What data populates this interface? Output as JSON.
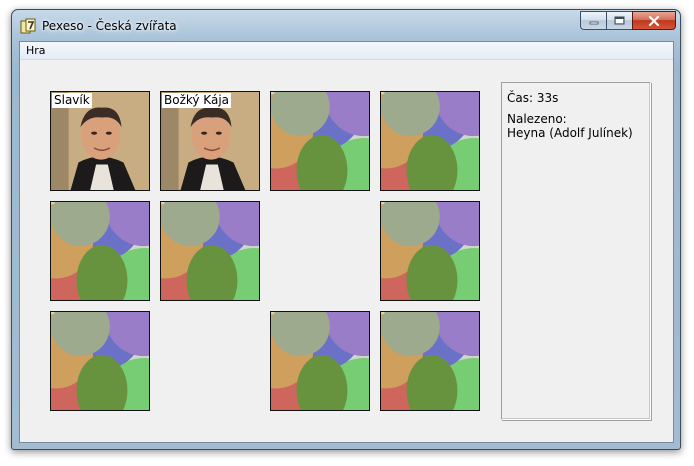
{
  "window": {
    "title": "Pexeso - Česká zvířata",
    "icon": "app-icon"
  },
  "menu": {
    "items": [
      {
        "label": "Hra"
      }
    ]
  },
  "cards": [
    {
      "state": "revealed",
      "label": "Slavík"
    },
    {
      "state": "revealed",
      "label": "Božký Kája"
    },
    {
      "state": "hidden"
    },
    {
      "state": "hidden"
    },
    {
      "state": "hidden"
    },
    {
      "state": "hidden"
    },
    {
      "state": "removed"
    },
    {
      "state": "hidden"
    },
    {
      "state": "hidden"
    },
    {
      "state": "removed"
    },
    {
      "state": "hidden"
    },
    {
      "state": "hidden"
    }
  ],
  "info": {
    "time_label": "Čas: 33s",
    "found_label": "Nalezeno:",
    "found_items": [
      "Heyna (Adolf Julínek)"
    ]
  },
  "colors": {
    "card_back_red": "#ff6060",
    "card_back_green": "#80f080",
    "card_back_blue": "#7070ff",
    "card_back_purple": "#b080ff",
    "card_back_orange": "#ffb060",
    "close_button": "#c0381e"
  }
}
